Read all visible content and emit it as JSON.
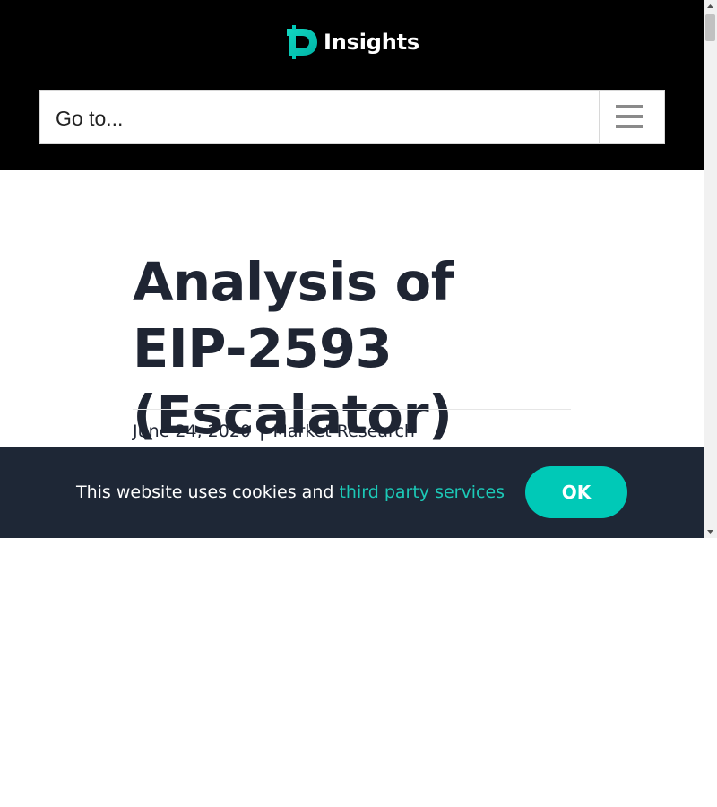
{
  "header": {
    "logo_text": "Insights",
    "goto_placeholder": "Go to..."
  },
  "article": {
    "title": "Analysis of EIP-2593 (Escalator)",
    "date": "June 24, 2020",
    "separator": "|",
    "category": "Market Research"
  },
  "cookie_banner": {
    "message": "This website uses cookies and ",
    "link_text": "third party services",
    "ok_label": "OK"
  },
  "icons": {
    "logo": "insights-logo-icon",
    "menu": "hamburger-menu-icon",
    "scroll_up": "scroll-up-arrow-icon",
    "scroll_down": "scroll-down-arrow-icon"
  },
  "colors": {
    "header_bg": "#000000",
    "accent": "#00c9b7",
    "text_dark": "#1f2533",
    "cookie_bg": "#1e2736"
  }
}
